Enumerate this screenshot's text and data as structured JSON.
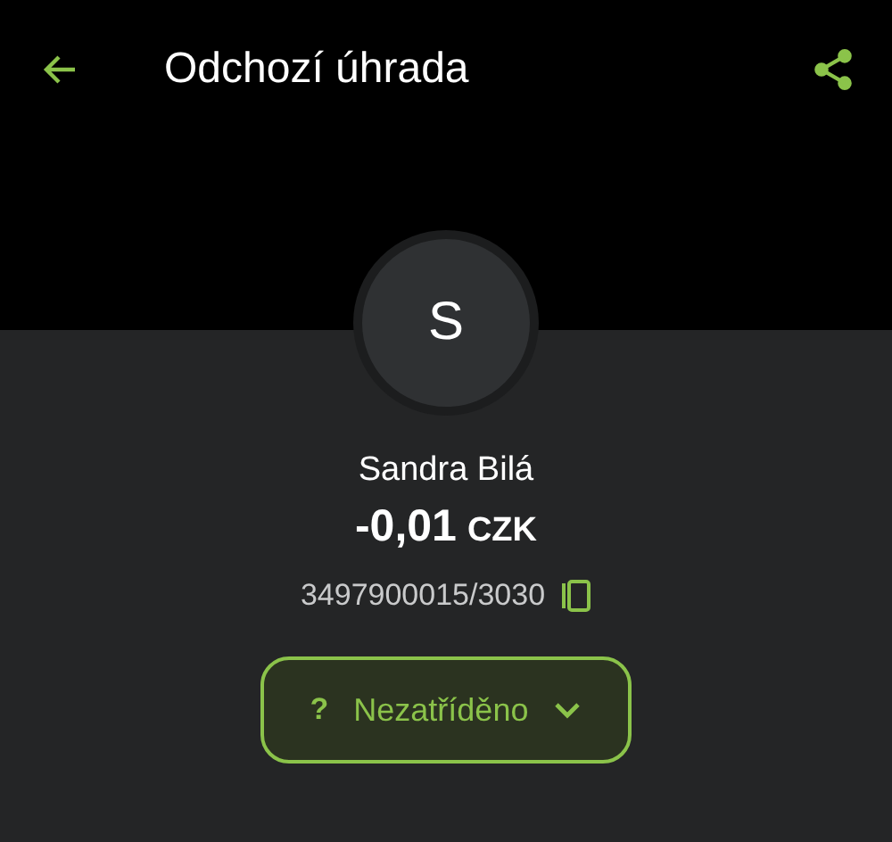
{
  "header": {
    "title": "Odchozí úhrada"
  },
  "counterparty": {
    "initial": "S",
    "name": "Sandra Bilá",
    "amount": "-0,01",
    "currency": "CZK",
    "account": "3497900015/3030"
  },
  "category": {
    "icon_char": "?",
    "label": "Nezatříděno"
  }
}
